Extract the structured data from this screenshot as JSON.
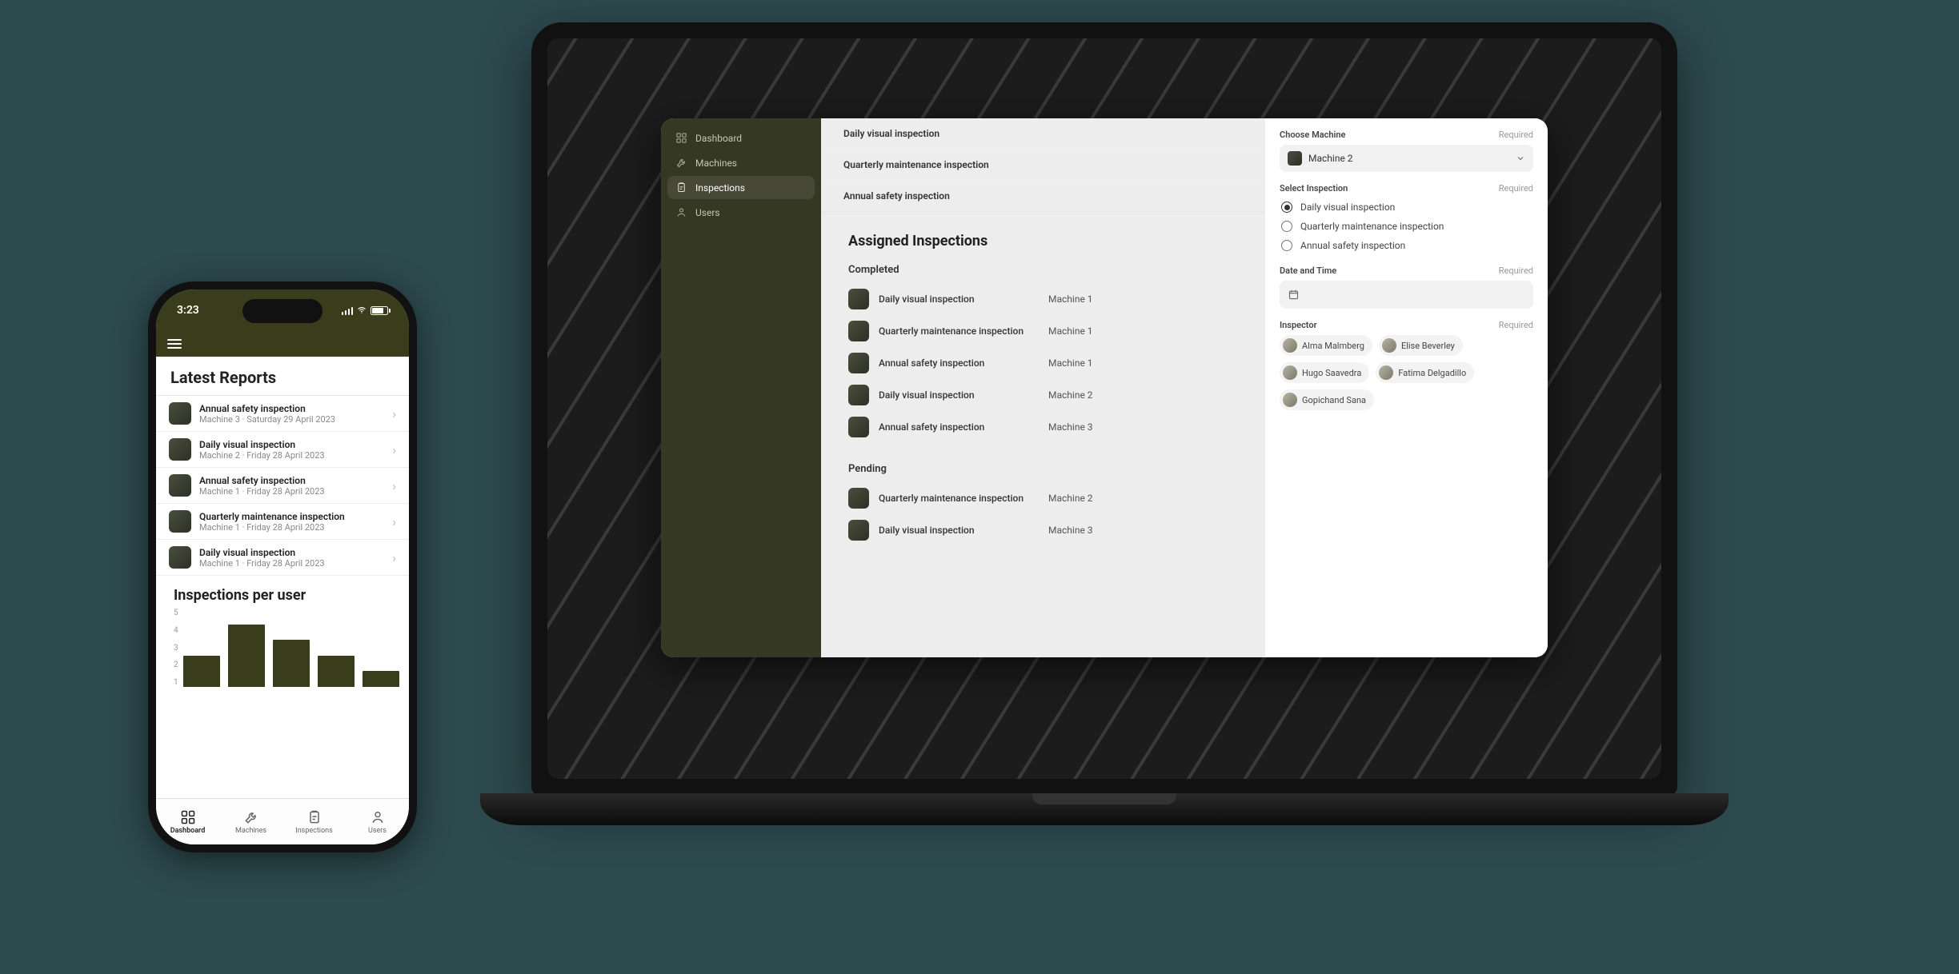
{
  "colors": {
    "accent": "#3a3d1c"
  },
  "phone": {
    "time": "3:23",
    "latest_reports_title": "Latest Reports",
    "reports": [
      {
        "title": "Annual safety inspection",
        "sub": "Machine 3 · Saturday 29 April 2023"
      },
      {
        "title": "Daily visual inspection",
        "sub": "Machine 2 · Friday 28 April 2023"
      },
      {
        "title": "Annual safety inspection",
        "sub": "Machine 1 · Friday 28 April 2023"
      },
      {
        "title": "Quarterly maintenance inspection",
        "sub": "Machine 1 · Friday 28 April 2023"
      },
      {
        "title": "Daily visual inspection",
        "sub": "Machine 1 · Friday 28 April 2023"
      }
    ],
    "chart_title": "Inspections per user",
    "tabs": {
      "dashboard": "Dashboard",
      "machines": "Machines",
      "inspections": "Inspections",
      "users": "Users"
    }
  },
  "laptop": {
    "sidebar": {
      "dashboard": "Dashboard",
      "machines": "Machines",
      "inspections": "Inspections",
      "users": "Users"
    },
    "inspection_types": [
      "Daily visual inspection",
      "Quarterly maintenance inspection",
      "Annual safety inspection"
    ],
    "assigned_title": "Assigned Inspections",
    "completed_label": "Completed",
    "completed": [
      {
        "title": "Daily visual inspection",
        "machine": "Machine 1"
      },
      {
        "title": "Quarterly maintenance inspection",
        "machine": "Machine 1"
      },
      {
        "title": "Annual safety inspection",
        "machine": "Machine 1"
      },
      {
        "title": "Daily visual inspection",
        "machine": "Machine 2"
      },
      {
        "title": "Annual safety inspection",
        "machine": "Machine 3"
      }
    ],
    "pending_label": "Pending",
    "pending": [
      {
        "title": "Quarterly maintenance inspection",
        "machine": "Machine 2"
      },
      {
        "title": "Daily visual inspection",
        "machine": "Machine 3"
      }
    ],
    "panel": {
      "choose_machine_label": "Choose Machine",
      "required_label": "Required",
      "machine_selected": "Machine 2",
      "select_inspection_label": "Select Inspection",
      "inspection_options": [
        "Daily visual inspection",
        "Quarterly maintenance inspection",
        "Annual safety inspection"
      ],
      "inspection_selected_index": 0,
      "date_label": "Date and Time",
      "inspector_label": "Inspector",
      "inspectors": [
        "Alma Malmberg",
        "Elise Beverley",
        "Hugo Saavedra",
        "Fatima Delgadillo",
        "Gopichand Sana"
      ]
    }
  },
  "chart_data": {
    "type": "bar",
    "title": "Inspections per user",
    "ylabel": "",
    "ylim": [
      0,
      5
    ],
    "values": [
      2,
      4,
      3,
      2,
      1
    ]
  }
}
